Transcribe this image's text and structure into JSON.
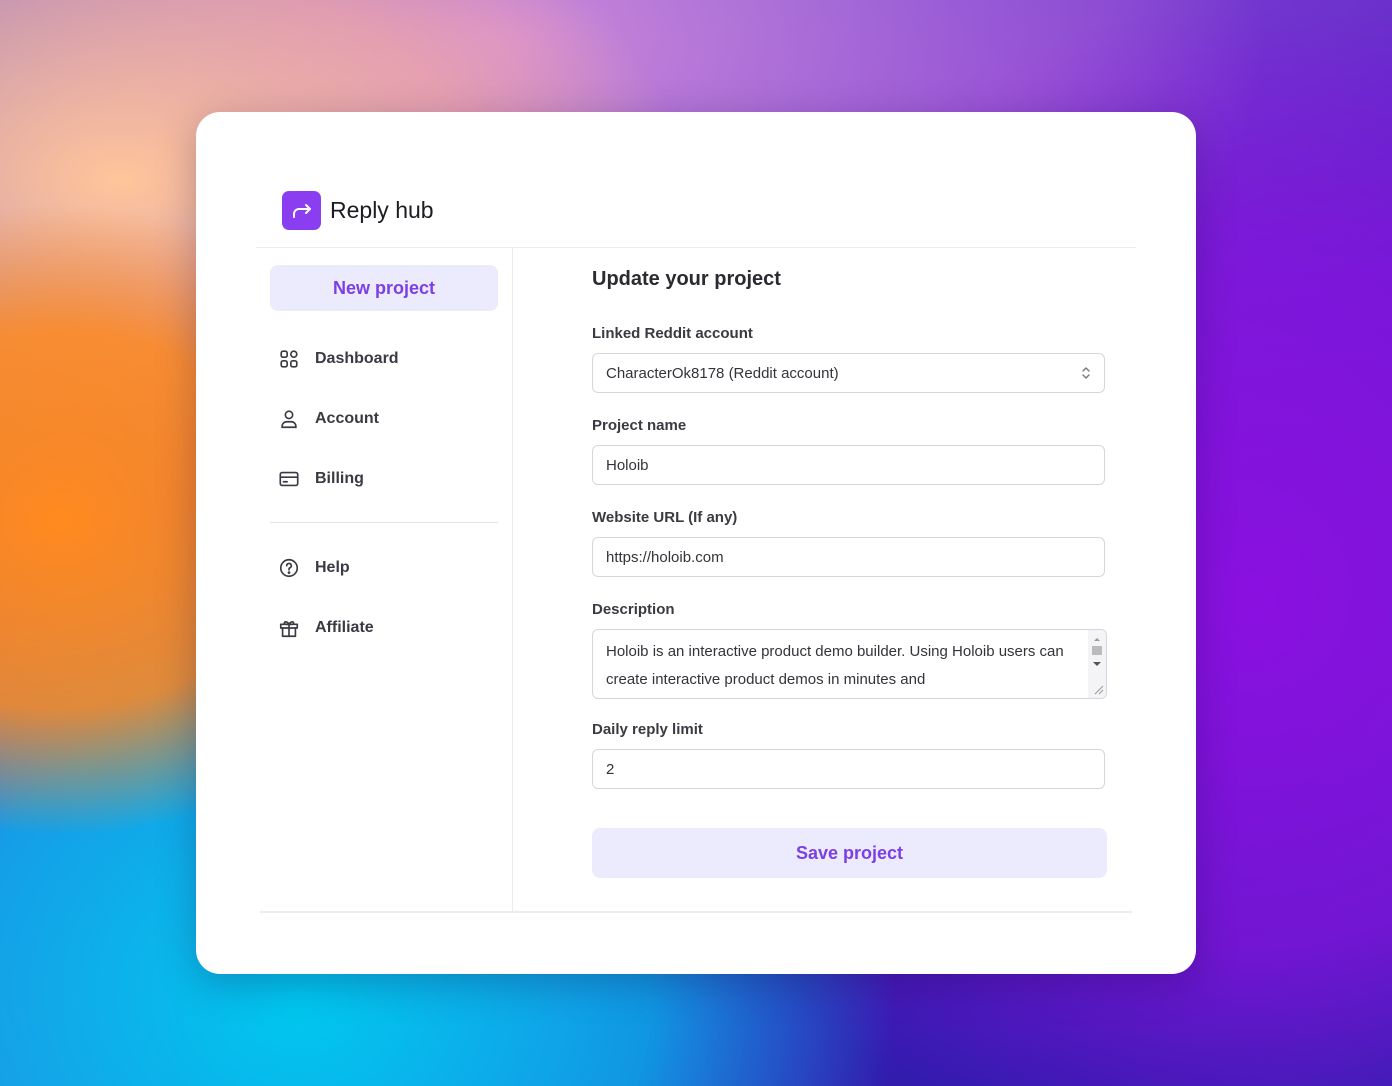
{
  "app": {
    "name": "Reply hub",
    "logo_icon": "share-arrow-icon",
    "accent": "#8b3ef0"
  },
  "sidebar": {
    "new_project_label": "New project",
    "items": [
      {
        "label": "Dashboard",
        "icon": "grid-icon"
      },
      {
        "label": "Account",
        "icon": "user-icon"
      },
      {
        "label": "Billing",
        "icon": "credit-card-icon"
      },
      {
        "label": "Help",
        "icon": "help-circle-icon"
      },
      {
        "label": "Affiliate",
        "icon": "gift-icon"
      }
    ]
  },
  "form": {
    "title": "Update your project",
    "reddit_account": {
      "label": "Linked Reddit account",
      "value": "CharacterOk8178 (Reddit account)"
    },
    "project_name": {
      "label": "Project name",
      "value": "Holoib"
    },
    "website_url": {
      "label": "Website URL (If any)",
      "value": "https://holoib.com"
    },
    "description": {
      "label": "Description",
      "value": "Holoib is an interactive product demo builder. Using Holoib users can create interactive product demos in minutes and"
    },
    "daily_limit": {
      "label": "Daily reply limit",
      "value": "2"
    },
    "save_label": "Save project"
  }
}
